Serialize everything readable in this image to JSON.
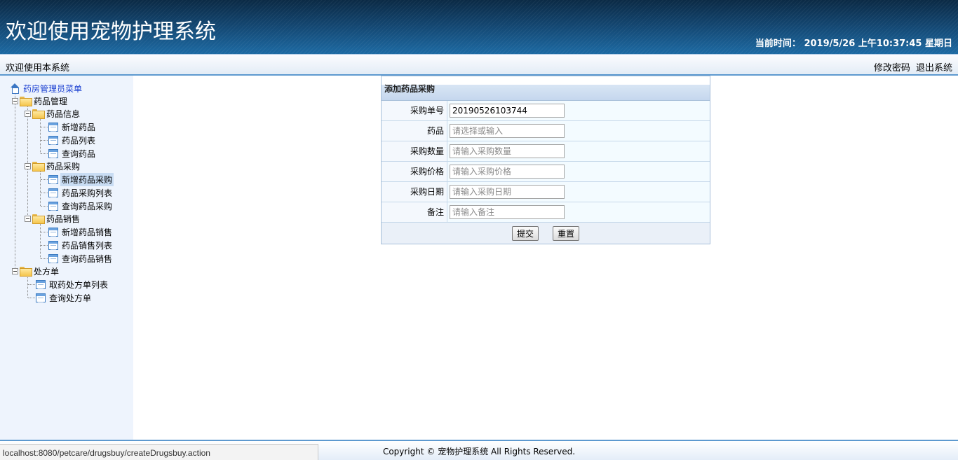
{
  "header": {
    "title": "欢迎使用宠物护理系统",
    "time_label": "当前时间：",
    "time_value": "2019/5/26 上午10:37:45 星期日"
  },
  "subbar": {
    "welcome": "欢迎使用本系统",
    "change_password": "修改密码",
    "logout": "退出系统"
  },
  "sidebar": {
    "root": "药房管理员菜单",
    "groups": [
      {
        "label": "药品管理",
        "children": [
          {
            "label": "药品信息",
            "items": [
              "新增药品",
              "药品列表",
              "查询药品"
            ]
          },
          {
            "label": "药品采购",
            "items": [
              "新增药品采购",
              "药品采购列表",
              "查询药品采购"
            ]
          },
          {
            "label": "药品销售",
            "items": [
              "新增药品销售",
              "药品销售列表",
              "查询药品销售"
            ]
          }
        ]
      },
      {
        "label": "处方单",
        "items": [
          "取药处方单列表",
          "查询处方单"
        ]
      }
    ],
    "selected": "新增药品采购"
  },
  "form": {
    "title": "添加药品采购",
    "fields": [
      {
        "label": "采购单号",
        "value": "20190526103744",
        "placeholder": ""
      },
      {
        "label": "药品",
        "value": "",
        "placeholder": "请选择或输入"
      },
      {
        "label": "采购数量",
        "value": "",
        "placeholder": "请输入采购数量"
      },
      {
        "label": "采购价格",
        "value": "",
        "placeholder": "请输入采购价格"
      },
      {
        "label": "采购日期",
        "value": "",
        "placeholder": "请输入采购日期"
      },
      {
        "label": "备注",
        "value": "",
        "placeholder": "请输入备注"
      }
    ],
    "submit": "提交",
    "reset": "重置"
  },
  "footer": {
    "copyright": "Copyright © 宠物护理系统 All Rights Reserved."
  },
  "statusbar": {
    "url": "localhost:8080/petcare/drugsbuy/createDrugsbuy.action"
  }
}
